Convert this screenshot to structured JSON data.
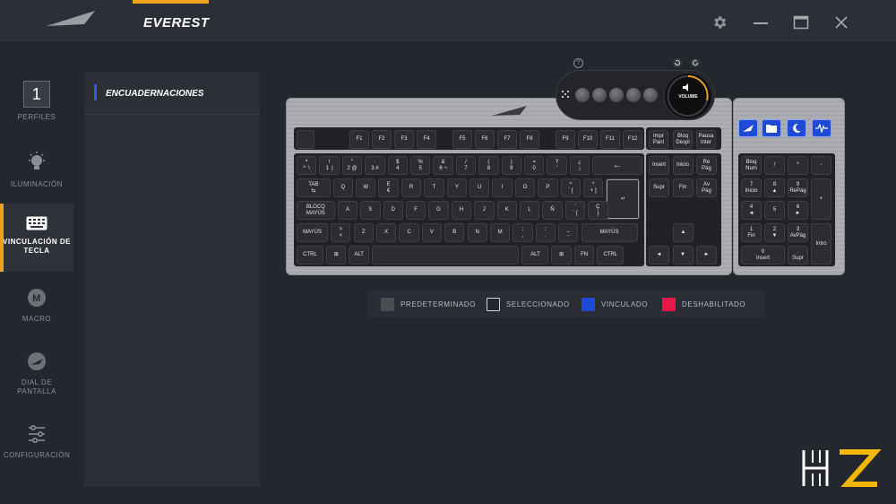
{
  "app": {
    "title": "EVEREST"
  },
  "window_controls": {
    "settings": "gear-icon",
    "minimize": "minimize-icon",
    "maximize": "maximize-icon",
    "close": "close-icon"
  },
  "sidebar": {
    "profile_number": "1",
    "items": [
      {
        "label": "PERFILES",
        "icon": "profile-number"
      },
      {
        "label": "ILUMINACIÓN",
        "icon": "bulb-icon"
      },
      {
        "label": "VINCULACIÓN DE\nTECLA",
        "icon": "keyboard-icon",
        "active": true
      },
      {
        "label": "MACRO",
        "icon": "macro-icon"
      },
      {
        "label": "DIAL DE\nPANTALLA",
        "icon": "dial-icon"
      },
      {
        "label": "CONFIGURACIÓN",
        "icon": "sliders-icon"
      }
    ]
  },
  "panel": {
    "header": "ENCUADERNACIONES"
  },
  "dial": {
    "help": "?",
    "volume_label": "VOLUME"
  },
  "keyboard": {
    "rows": [
      [
        "",
        "F1",
        "F2",
        "F3",
        "F4",
        "F5",
        "F6",
        "F7",
        "F8",
        "F9",
        "F10",
        "F11",
        "F12",
        "Impr\nPant",
        "Bloq\nDespl",
        "Pausa\nInter"
      ],
      [
        "ª\nº  \\",
        "!\n1  |",
        "\"\n2 @",
        "·\n3 #",
        "$\n4",
        "%\n5",
        "&\n6 ¬",
        "/\n7",
        "(\n8",
        ")\n9",
        "=\n0",
        "?\n'",
        "¿\n¡",
        "←",
        "Insert",
        "Inicio",
        "Re\nPág"
      ],
      [
        "TAB\n⇆",
        "Q",
        "W",
        "E\n€",
        "R",
        "T",
        "Y",
        "U",
        "I",
        "O",
        "P",
        "^\n` [",
        "*\n+ ]",
        "↵",
        "Supr",
        "Fin",
        "Av\nPág"
      ],
      [
        "BLOCQ\nMAYÚS",
        "A",
        "S",
        "D",
        "F",
        "G",
        "H",
        "J",
        "K",
        "L",
        "Ñ",
        "¨\n´ {",
        "Ç\n}"
      ],
      [
        "MAYÚS",
        ">\n<",
        "Z",
        "X",
        "C",
        "V",
        "B",
        "N",
        "M",
        ";\n,",
        ":\n.",
        "_\n-",
        "MAYÚS",
        "▲"
      ],
      [
        "CTRL",
        "⊞",
        "ALT",
        "",
        "ALT",
        "⊞",
        "FN",
        "CTRL",
        "◄",
        "▼",
        "►"
      ]
    ],
    "media_keys": [
      "backlight-icon",
      "folder-icon",
      "moon-icon",
      "pulse-icon"
    ],
    "numpad": [
      [
        "Bloq\nNum",
        "/",
        "*",
        "-"
      ],
      [
        "7\nInicio",
        "8\n▲",
        "9\nRePág",
        "+"
      ],
      [
        "4\n◄",
        "5",
        "6\n►"
      ],
      [
        "1\nFin",
        "2\n▼",
        "3\nAvPág",
        "Intro"
      ],
      [
        "0\nInsert",
        ".\nSupr"
      ]
    ]
  },
  "legend": [
    {
      "label": "PREDETERMINADO",
      "color": "#4a4d52"
    },
    {
      "label": "SELECCIONADO",
      "color": "#24272d"
    },
    {
      "label": "VINCULADO",
      "color": "#1f4ad6"
    },
    {
      "label": "DESHABILITADO",
      "color": "#e8184a"
    }
  ],
  "colors": {
    "accent": "#f0a21f",
    "bound": "#1f4ad6",
    "disabled": "#e8184a"
  },
  "watermark": "HZ"
}
